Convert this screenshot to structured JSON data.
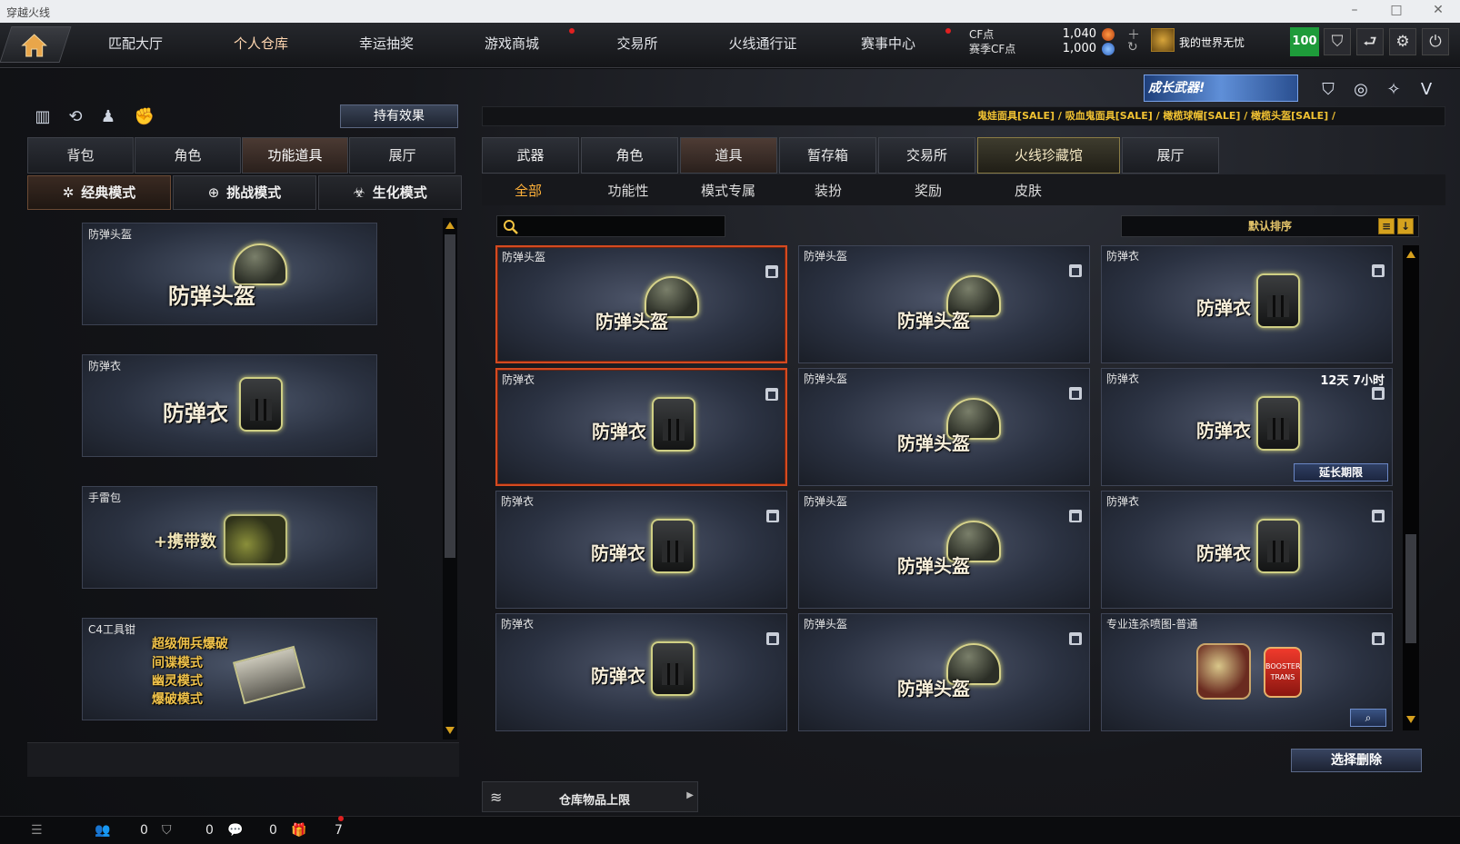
{
  "window": {
    "title": "穿越火线"
  },
  "topnav": {
    "tabs": [
      "匹配大厅",
      "个人仓库",
      "幸运抽奖",
      "游戏商城",
      "交易所",
      "火线通行证",
      "赛事中心"
    ],
    "active_index": 1,
    "cf_label": "CF点",
    "cf_value": "1,040",
    "season_label": "赛季CF点",
    "season_value": "1,000",
    "player_name": "我的世界无忧",
    "level": "100"
  },
  "left_panel": {
    "hold_effect_label": "持有效果",
    "tabs": [
      "背包",
      "角色",
      "功能道具",
      "展厅"
    ],
    "active_tab_index": 2,
    "modes": [
      "经典模式",
      "挑战模式",
      "生化模式"
    ],
    "active_mode_index": 0,
    "items": [
      {
        "label": "防弹头盔",
        "art_text": "防弹头盔"
      },
      {
        "label": "防弹衣",
        "art_text": "防弹衣"
      },
      {
        "label": "手雷包",
        "art_text": "+携带数"
      },
      {
        "label": "C4工具钳",
        "art_lines": [
          "超级佣兵爆破",
          "间谍模式",
          "幽灵模式",
          "爆破模式"
        ]
      }
    ]
  },
  "right_panel": {
    "banner_text": "成长武器!",
    "marquee": "鬼娃面具[SALE] / 吸血鬼面具[SALE] / 橄榄球帽[SALE] / 橄榄头盔[SALE] /",
    "tabs": [
      "武器",
      "角色",
      "道具",
      "暂存箱",
      "交易所",
      "火线珍藏馆",
      "展厅"
    ],
    "active_tab_index": 2,
    "subtabs": [
      "全部",
      "功能性",
      "模式专属",
      "装扮",
      "奖励",
      "皮肤"
    ],
    "active_subtab_index": 0,
    "search_placeholder": "",
    "sort_label": "默认排序",
    "grid": [
      {
        "label": "防弹头盔",
        "art": "防弹头盔",
        "selected": true
      },
      {
        "label": "防弹头盔",
        "art": "防弹头盔"
      },
      {
        "label": "防弹衣",
        "art": "防弹衣"
      },
      {
        "label": "防弹衣",
        "art": "防弹衣",
        "selected": true
      },
      {
        "label": "防弹头盔",
        "art": "防弹头盔"
      },
      {
        "label": "防弹衣",
        "art": "防弹衣",
        "time": "12天 7小时",
        "extend_label": "延长期限"
      },
      {
        "label": "防弹衣",
        "art": "防弹衣"
      },
      {
        "label": "防弹头盔",
        "art": "防弹头盔"
      },
      {
        "label": "防弹衣",
        "art": "防弹衣"
      },
      {
        "label": "防弹衣",
        "art": "防弹衣"
      },
      {
        "label": "防弹头盔",
        "art": "防弹头盔"
      },
      {
        "label": "专业连杀喷图-普通",
        "art": "",
        "badge": "BOOSTER TRANS"
      }
    ],
    "delete_label": "选择删除",
    "capacity_label": "仓库物品上限"
  },
  "statusbar": {
    "count1": "0",
    "count2": "0",
    "count3": "0",
    "count4": "7"
  },
  "colors": {
    "accent": "#ffb13a",
    "select_border": "#d54a20",
    "level_bg": "#1e9b3a"
  }
}
